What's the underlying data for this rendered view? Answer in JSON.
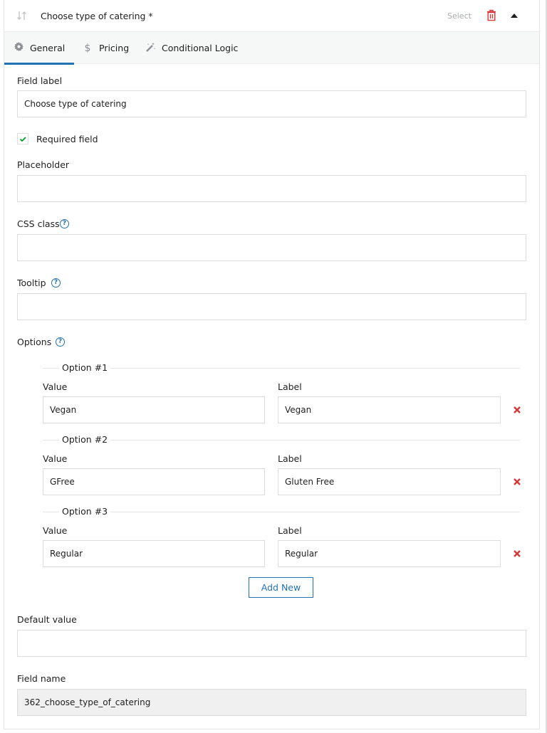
{
  "header": {
    "title": "Choose type of catering *",
    "field_type": "Select",
    "icons": {
      "sort": "sort-arrows-icon",
      "delete": "trash-icon",
      "collapse": "caret-up-icon"
    }
  },
  "tabs": [
    {
      "label": "General",
      "icon": "gear-icon",
      "active": true
    },
    {
      "label": "Pricing",
      "icon": "dollar-icon",
      "active": false
    },
    {
      "label": "Conditional Logic",
      "icon": "magic-wand-icon",
      "active": false
    }
  ],
  "form": {
    "field_label": {
      "label": "Field label",
      "value": "Choose type of catering"
    },
    "required": {
      "label": "Required field",
      "checked": true
    },
    "placeholder": {
      "label": "Placeholder",
      "value": ""
    },
    "css_class": {
      "label": "CSS class",
      "value": "",
      "help": "?"
    },
    "tooltip": {
      "label": "Tooltip",
      "value": "",
      "help": "?"
    },
    "options": {
      "label": "Options",
      "help": "?",
      "value_label": "Value",
      "label_label": "Label",
      "items": [
        {
          "legend": "Option #1",
          "value": "Vegan",
          "label": "Vegan"
        },
        {
          "legend": "Option #2",
          "value": "GFree",
          "label": "Gluten Free"
        },
        {
          "legend": "Option #3",
          "value": "Regular",
          "label": "Regular"
        }
      ],
      "add_new_label": "Add New"
    },
    "default_value": {
      "label": "Default value",
      "value": ""
    },
    "field_name": {
      "label": "Field name",
      "value": "362_choose_type_of_catering"
    }
  },
  "colors": {
    "accent": "#2271b1",
    "danger": "#d63638",
    "check": "#00a32a"
  }
}
